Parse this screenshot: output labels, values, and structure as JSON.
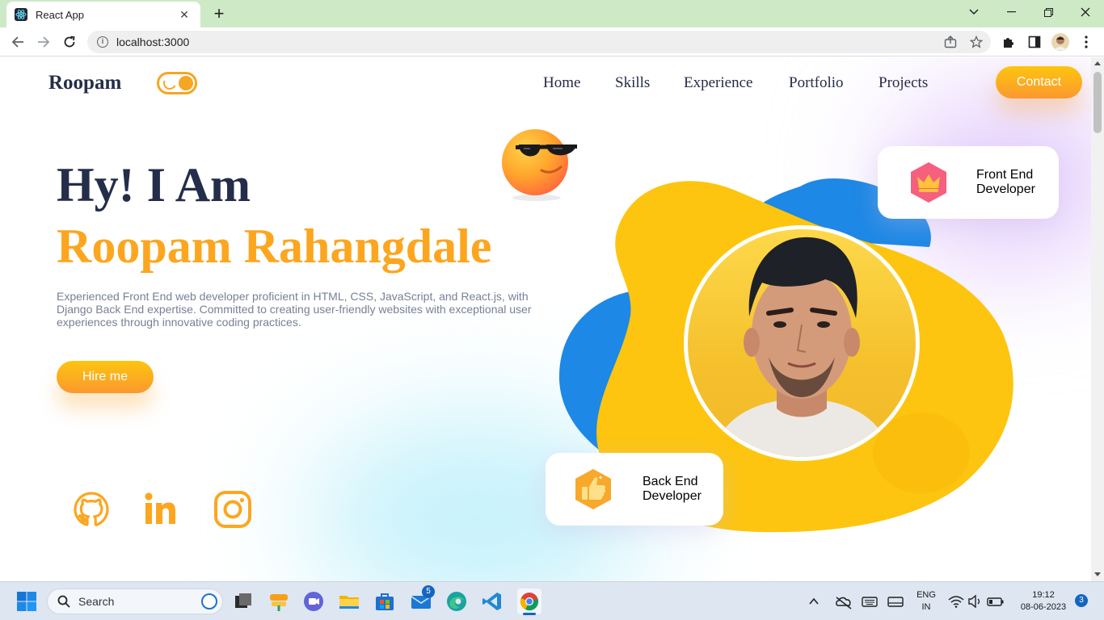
{
  "browser": {
    "tab_title": "React App",
    "url": "localhost:3000"
  },
  "page": {
    "logo": "Roopam",
    "nav": [
      "Home",
      "Skills",
      "Experience",
      "Portfolio",
      "Projects"
    ],
    "contact_label": "Contact",
    "greeting": "Hy! I Am",
    "name": "Roopam Rahangdale",
    "description": "Experienced Front End web developer proficient in HTML, CSS, JavaScript, and React.js, with Django Back End expertise. Committed to creating user-friendly websites with exceptional user experiences through innovative coding practices.",
    "hire_label": "Hire me",
    "cards": {
      "front_line1": "Front End",
      "front_line2": "Developer",
      "back_line1": "Back End",
      "back_line2": "Developer"
    },
    "social": [
      "github-icon",
      "linkedin-icon",
      "instagram-icon"
    ]
  },
  "colors": {
    "accent": "#fca61f",
    "dark": "#242d49",
    "blob_yellow": "#fdc50f",
    "blob_blue": "#1d88e5"
  },
  "taskbar": {
    "search_placeholder": "Search",
    "mail_badge": "5",
    "lang_line1": "ENG",
    "lang_line2": "IN",
    "time": "19:12",
    "date": "08-06-2023",
    "notification_count": "3"
  }
}
